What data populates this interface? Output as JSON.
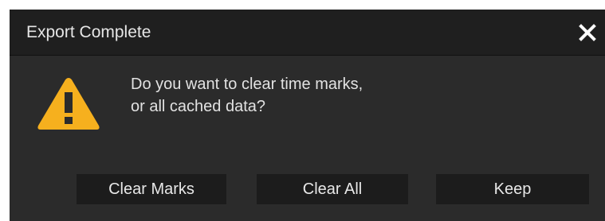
{
  "dialog": {
    "title": "Export Complete",
    "close_icon": "close-icon",
    "warning_icon": "warning-icon",
    "message": "Do you want to clear time marks, or all cached data?",
    "buttons": [
      {
        "label": "Clear Marks"
      },
      {
        "label": "Clear All"
      },
      {
        "label": "Keep"
      }
    ]
  },
  "colors": {
    "dialog_bg": "#2b2b2b",
    "titlebar_bg": "#1f1f1f",
    "button_bg": "#1c1c1c",
    "warning": "#f6b01e",
    "text": "#e2e2e2"
  }
}
